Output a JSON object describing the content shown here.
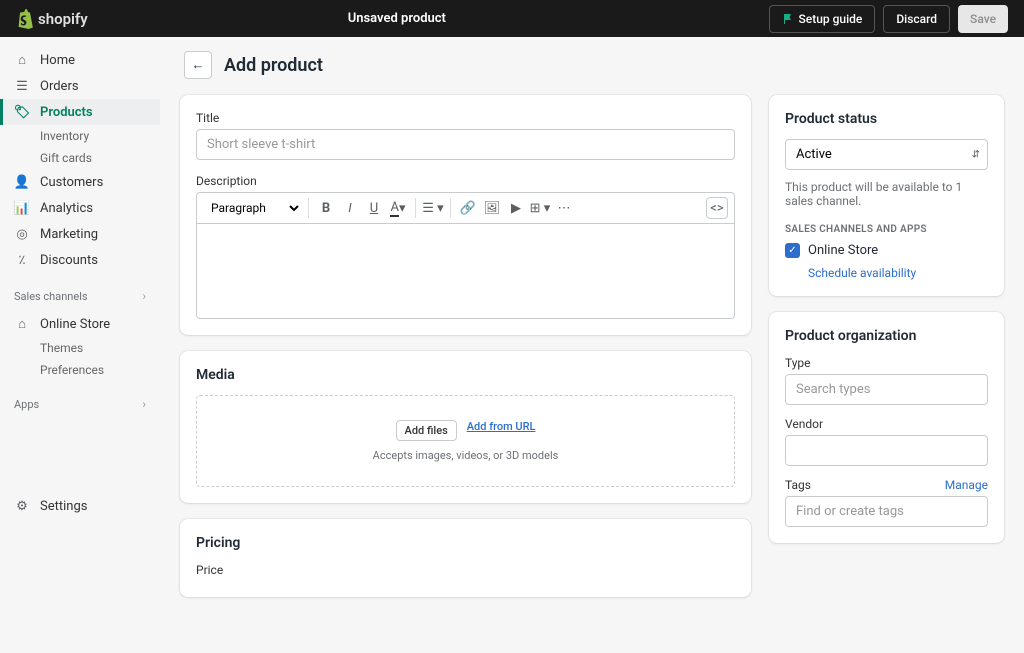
{
  "topbar": {
    "logo_text": "shopify",
    "center_title": "Unsaved product",
    "setup_label": "Setup guide",
    "discard_label": "Discard",
    "save_label": "Save"
  },
  "sidebar": {
    "home": "Home",
    "orders": "Orders",
    "products": "Products",
    "inventory": "Inventory",
    "gift_cards": "Gift cards",
    "customers": "Customers",
    "analytics": "Analytics",
    "marketing": "Marketing",
    "discounts": "Discounts",
    "sales_channels_heading": "Sales channels",
    "online_store": "Online Store",
    "themes": "Themes",
    "preferences": "Preferences",
    "apps_heading": "Apps",
    "settings": "Settings"
  },
  "page": {
    "title": "Add product"
  },
  "form": {
    "title_label": "Title",
    "title_placeholder": "Short sleeve t-shirt",
    "description_label": "Description",
    "paragraph_option": "Paragraph",
    "media_heading": "Media",
    "add_files": "Add files",
    "add_from_url": "Add from URL",
    "media_hint": "Accepts images, videos, or 3D models",
    "pricing_heading": "Pricing",
    "price_label": "Price"
  },
  "status": {
    "heading": "Product status",
    "active": "Active",
    "hint": "This product will be available to 1 sales channel.",
    "channels_heading": "SALES CHANNELS AND APPS",
    "online_store": "Online Store",
    "schedule": "Schedule availability"
  },
  "org": {
    "heading": "Product organization",
    "type_label": "Type",
    "type_placeholder": "Search types",
    "vendor_label": "Vendor",
    "tags_label": "Tags",
    "manage": "Manage",
    "tags_placeholder": "Find or create tags"
  }
}
